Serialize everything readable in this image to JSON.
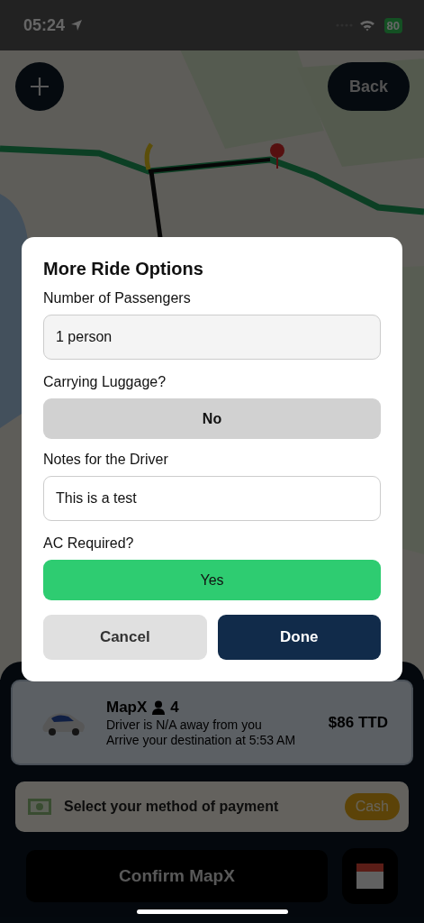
{
  "status_bar": {
    "time": "05:24",
    "battery": "80"
  },
  "map_controls": {
    "back_button": "Back"
  },
  "modal": {
    "title": "More Ride Options",
    "fields": [
      {
        "kind": "select",
        "label": "Number of Passengers",
        "value": "1 person"
      },
      {
        "kind": "toggle",
        "label": "Carrying Luggage?",
        "value": "No",
        "on": false
      },
      {
        "kind": "text",
        "label": "Notes for the Driver",
        "value": "This is a test"
      },
      {
        "kind": "toggle",
        "label": "AC Required?",
        "value": "Yes",
        "on": true
      }
    ],
    "buttons": [
      {
        "kind": "cancel",
        "label": "Cancel"
      },
      {
        "kind": "done",
        "label": "Done"
      }
    ]
  },
  "ride": {
    "name": "MapX",
    "seats": "4",
    "driver_eta": "Driver is N/A away from you",
    "arrival": "Arrive your destination at 5:53 AM",
    "price": "$86 TTD"
  },
  "payment": {
    "label": "Select your method of payment",
    "method": "Cash"
  },
  "confirm_button": "Confirm MapX"
}
